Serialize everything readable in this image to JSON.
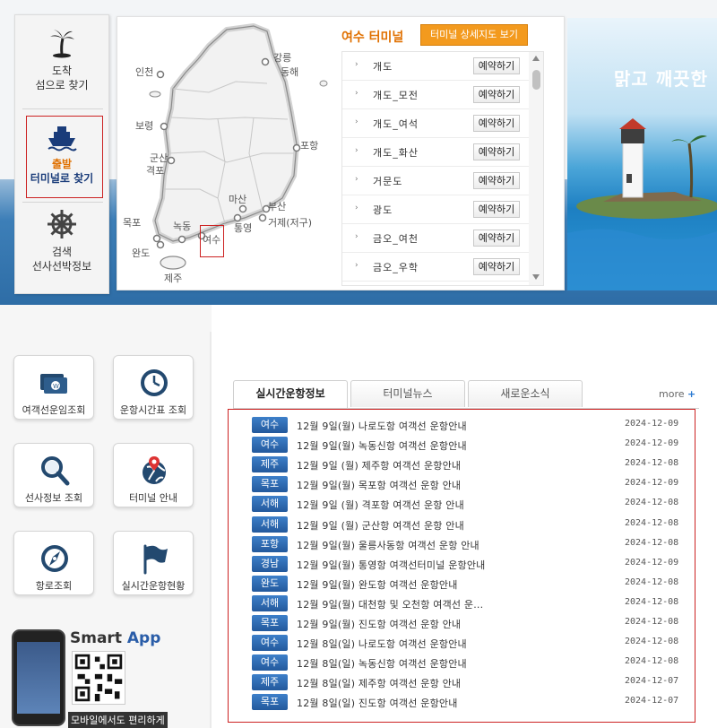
{
  "left_nav": {
    "arrival": {
      "line1": "도착",
      "line2": "섬으로 찾기",
      "icon": "palm-tree-icon"
    },
    "departure": {
      "line1": "출발",
      "line2": "터미널로 찾기",
      "icon": "ship-icon"
    },
    "search": {
      "line1": "검색",
      "line2": "선사선박정보",
      "icon": "ship-wheel-icon"
    }
  },
  "map": {
    "cities": [
      "인천",
      "강릉",
      "동해",
      "보령",
      "군산",
      "격포",
      "포항",
      "마산",
      "부산",
      "거제(저구)",
      "통영",
      "목포",
      "녹동",
      "여수",
      "완도",
      "제주"
    ]
  },
  "terminal": {
    "title": "여수 터미널",
    "detail_button": "터미널 상세지도 보기",
    "reserve_label": "예약하기",
    "items": [
      "개도",
      "개도_모전",
      "개도_여석",
      "개도_화산",
      "거문도",
      "광도",
      "금오_여천",
      "금오_우학"
    ]
  },
  "banner": {
    "text": "맑고 깨끗한"
  },
  "quick_menu": [
    {
      "label": "여객선운임조회",
      "icon": "fare-money-icon"
    },
    {
      "label": "운항시간표 조회",
      "icon": "clock-icon"
    },
    {
      "label": "선사정보 조회",
      "icon": "magnifier-icon"
    },
    {
      "label": "터미널 안내",
      "icon": "globe-pin-icon"
    },
    {
      "label": "항로조회",
      "icon": "compass-icon"
    },
    {
      "label": "실시간운항현황",
      "icon": "flag-icon"
    }
  ],
  "smart_app": {
    "title_1": "Smart",
    "title_2": "App",
    "caption": "모바일에서도 편리하게"
  },
  "news": {
    "tabs": [
      "실시간운항정보",
      "터미널뉴스",
      "새로운소식"
    ],
    "more": "more",
    "rows": [
      {
        "region": "여수",
        "title": "12월 9일(월) 나로도항 여객선 운항안내",
        "date": "2024-12-09"
      },
      {
        "region": "여수",
        "title": "12월 9일(월) 녹동신항 여객선 운항안내",
        "date": "2024-12-09"
      },
      {
        "region": "제주",
        "title": "12월 9일 (월) 제주항 여객선 운항안내",
        "date": "2024-12-08"
      },
      {
        "region": "목포",
        "title": "12월 9일(월) 목포항 여객선 운항 안내",
        "date": "2024-12-09"
      },
      {
        "region": "서해",
        "title": "12월 9일 (월) 격포항 여객선 운항 안내",
        "date": "2024-12-08"
      },
      {
        "region": "서해",
        "title": "12월 9일 (월) 군산항 여객선 운항 안내",
        "date": "2024-12-08"
      },
      {
        "region": "포항",
        "title": "12월 9일(월) 울릉사동항 여객선 운항 안내",
        "date": "2024-12-08"
      },
      {
        "region": "경남",
        "title": "12월 9일(월) 통영항 여객선터미널 운항안내",
        "date": "2024-12-09"
      },
      {
        "region": "완도",
        "title": "12월 9일(월) 완도항 여객선 운항안내",
        "date": "2024-12-08"
      },
      {
        "region": "서해",
        "title": "12월 9일(월) 대천항 및 오천항 여객선 운...",
        "date": "2024-12-08"
      },
      {
        "region": "목포",
        "title": "12월 9일(월) 진도항 여객선 운항 안내",
        "date": "2024-12-08"
      },
      {
        "region": "여수",
        "title": "12월 8일(일) 나로도항 여객선 운항안내",
        "date": "2024-12-08"
      },
      {
        "region": "여수",
        "title": "12월 8일(일) 녹동신항 여객선 운항안내",
        "date": "2024-12-08"
      },
      {
        "region": "제주",
        "title": "12월 8일(일) 제주항 여객선 운항 안내",
        "date": "2024-12-07"
      },
      {
        "region": "목포",
        "title": "12월 8일(일) 진도항 여객선 운항안내",
        "date": "2024-12-07"
      }
    ]
  }
}
